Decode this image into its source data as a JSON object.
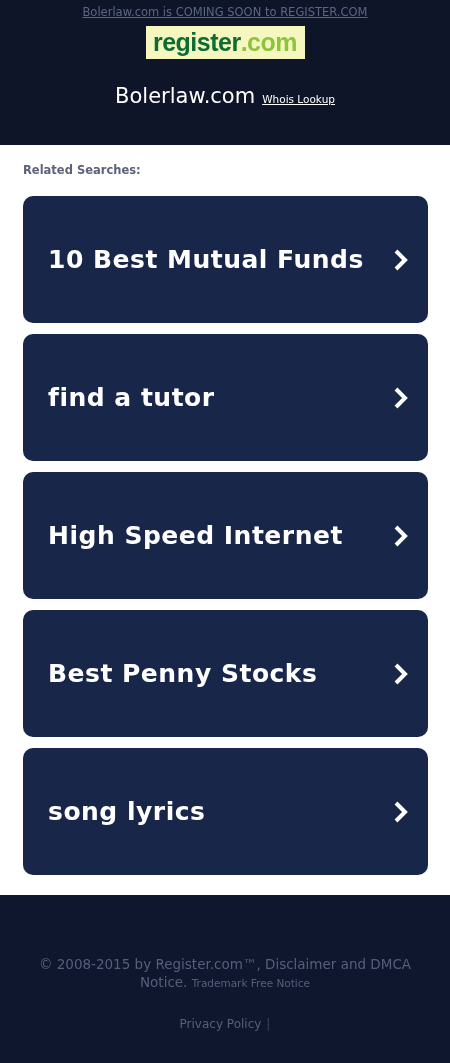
{
  "header": {
    "notice_link": "Bolerlaw.com is COMING SOON to REGISTER.COM",
    "logo": {
      "name": "register",
      "suffix": ".com"
    },
    "domain": "Bolerlaw.com",
    "whois_link": "Whois Lookup"
  },
  "related": {
    "heading": "Related Searches:",
    "items": [
      {
        "label": "10 Best Mutual Funds"
      },
      {
        "label": "find a tutor"
      },
      {
        "label": "High Speed Internet"
      },
      {
        "label": "Best Penny Stocks"
      },
      {
        "label": "song lyrics"
      }
    ]
  },
  "footer": {
    "copyright": "© 2008-2015 by Register.com™, Disclaimer and DMCA Notice.",
    "trademark_link": "Trademark Free Notice",
    "privacy_link": "Privacy Policy",
    "separator": "|"
  }
}
